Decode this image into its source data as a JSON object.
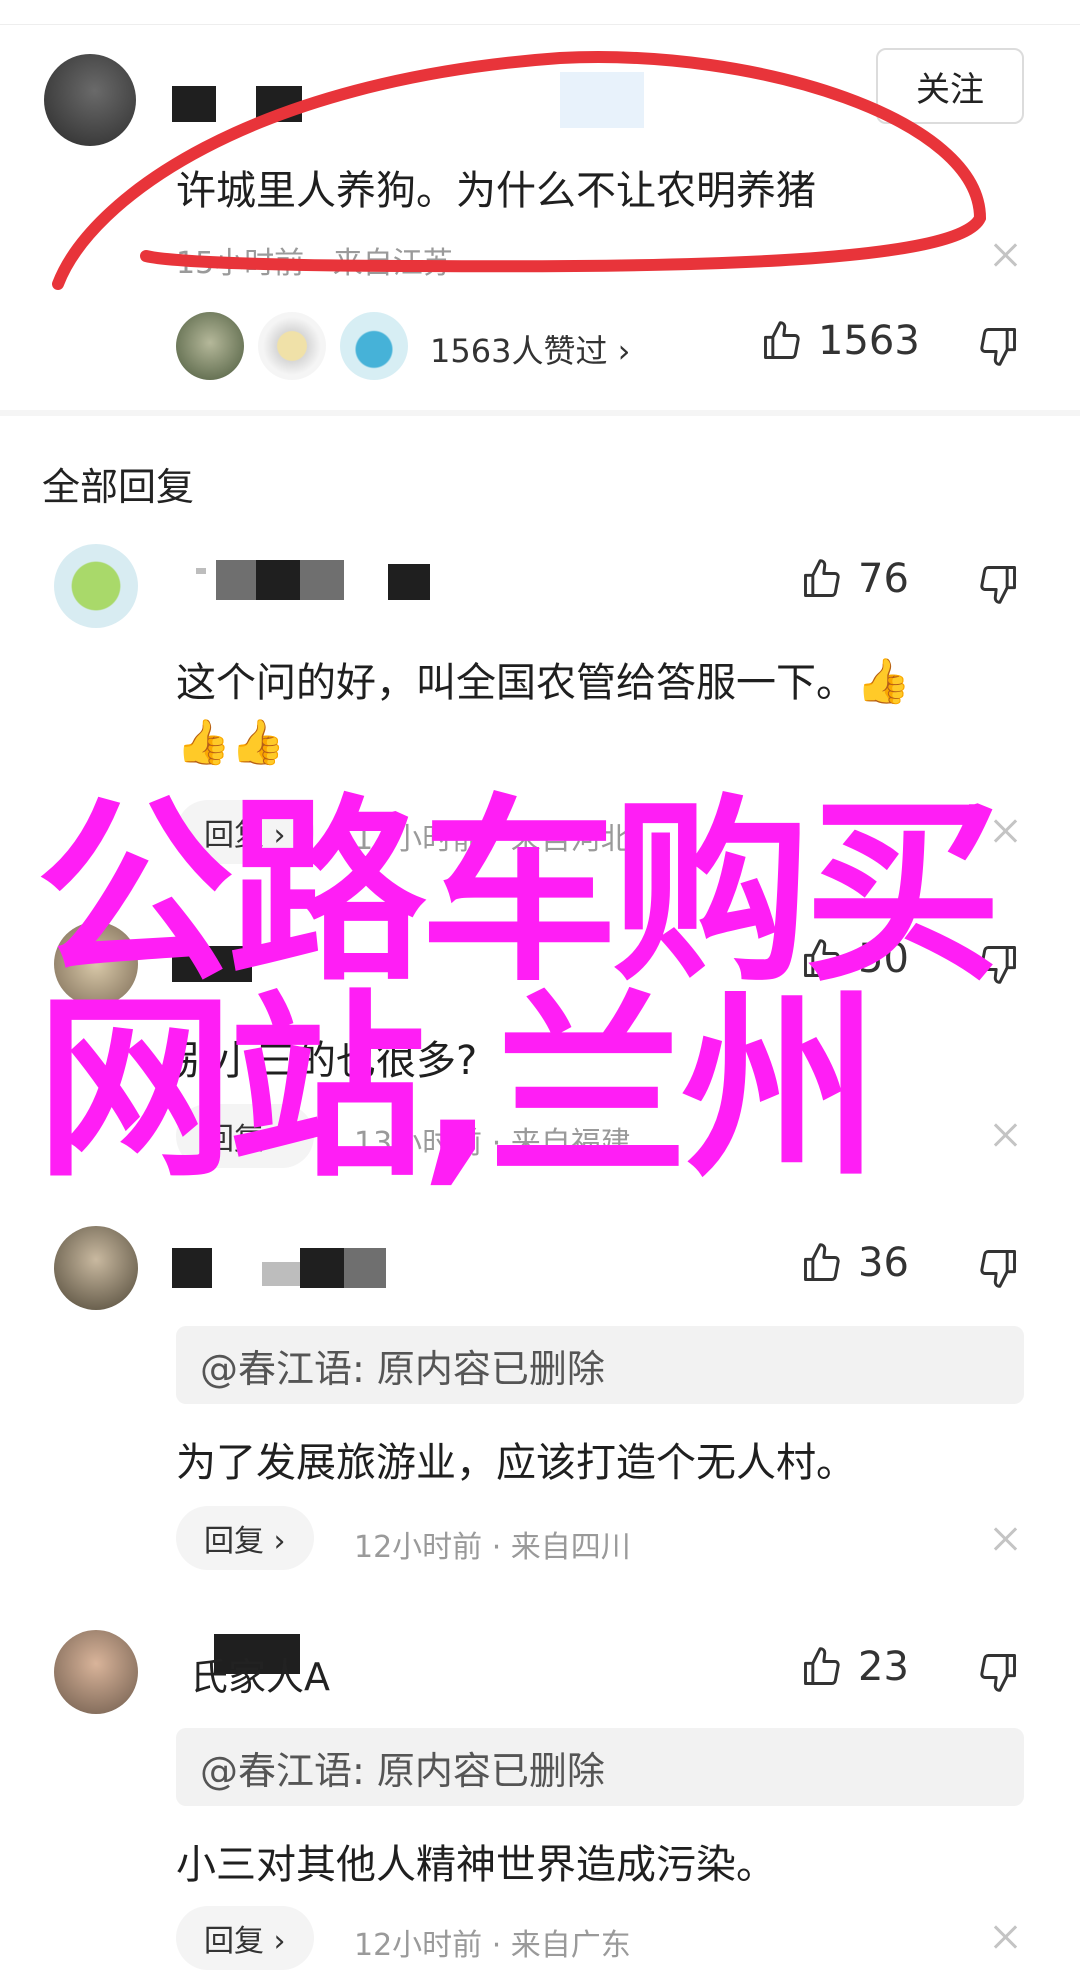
{
  "top_comment": {
    "follow_label": "关注",
    "text": "许城里人养狗。为什么不让农明养猪",
    "meta": "15小时前 · 来自江苏",
    "liked_by": "1563人赞过 ›",
    "like_count": "1563"
  },
  "section_title": "全部回复",
  "replies": [
    {
      "like_count": "76",
      "text": "这个问的好，叫全国农管给答服一下。",
      "reply_label": "回复 ›",
      "meta": "12小时前 · 来自河北"
    },
    {
      "like_count": "50",
      "text": "别小三的也很多?",
      "reply_label": "回复 ›",
      "meta": "13小时前 · 来自福建"
    },
    {
      "like_count": "36",
      "quote": "@春江语: 原内容已删除",
      "text": "为了发展旅游业，应该打造个无人村。",
      "reply_label": "回复 ›",
      "meta": "12小时前 · 来自四川"
    },
    {
      "name_visible": "氏家人A",
      "like_count": "23",
      "quote": "@春江语: 原内容已删除",
      "text": "小三对其他人精神世界造成污染。",
      "reply_label": "回复 ›",
      "meta": "12小时前 · 来自广东"
    }
  ],
  "overlay": {
    "line1": "公路车购买",
    "line2": "网站,兰州"
  },
  "colors": {
    "overlay_magenta": "#ff1ef5",
    "annotation_red": "#e8343a"
  },
  "icons": [
    "thumbs-up-icon",
    "thumbs-down-icon",
    "close-icon",
    "thumbs-up-emoji"
  ]
}
